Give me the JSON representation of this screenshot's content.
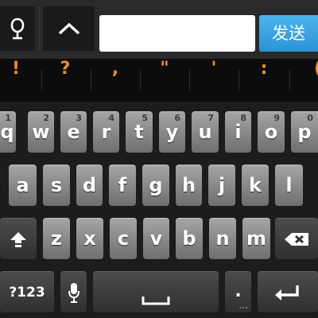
{
  "toolbar": {
    "mic_icon": "mic-outline-icon",
    "collapse_icon": "chevron-up-icon",
    "input_value": "",
    "send_label": "发送"
  },
  "suggestions": [
    "!",
    "?",
    ",",
    "\"",
    "'",
    ":",
    "("
  ],
  "keyboard": {
    "row1": [
      {
        "label": "q",
        "hint": "1"
      },
      {
        "label": "w",
        "hint": "2"
      },
      {
        "label": "e",
        "hint": "3"
      },
      {
        "label": "r",
        "hint": "4"
      },
      {
        "label": "t",
        "hint": "5"
      },
      {
        "label": "y",
        "hint": "6"
      },
      {
        "label": "u",
        "hint": "7"
      },
      {
        "label": "i",
        "hint": "8"
      },
      {
        "label": "o",
        "hint": "9"
      },
      {
        "label": "p",
        "hint": "0"
      }
    ],
    "row2": [
      "a",
      "s",
      "d",
      "f",
      "g",
      "h",
      "j",
      "k",
      "l"
    ],
    "row3": [
      "z",
      "x",
      "c",
      "v",
      "b",
      "n",
      "m"
    ],
    "shift_icon": "shift-arrow-icon",
    "backspace_icon": "backspace-icon",
    "symbols_label": "?123",
    "voice_icon": "microphone-icon",
    "space_icon": "space-bar-icon",
    "period_label": ".",
    "period_hint": "...",
    "enter_icon": "enter-return-icon"
  }
}
